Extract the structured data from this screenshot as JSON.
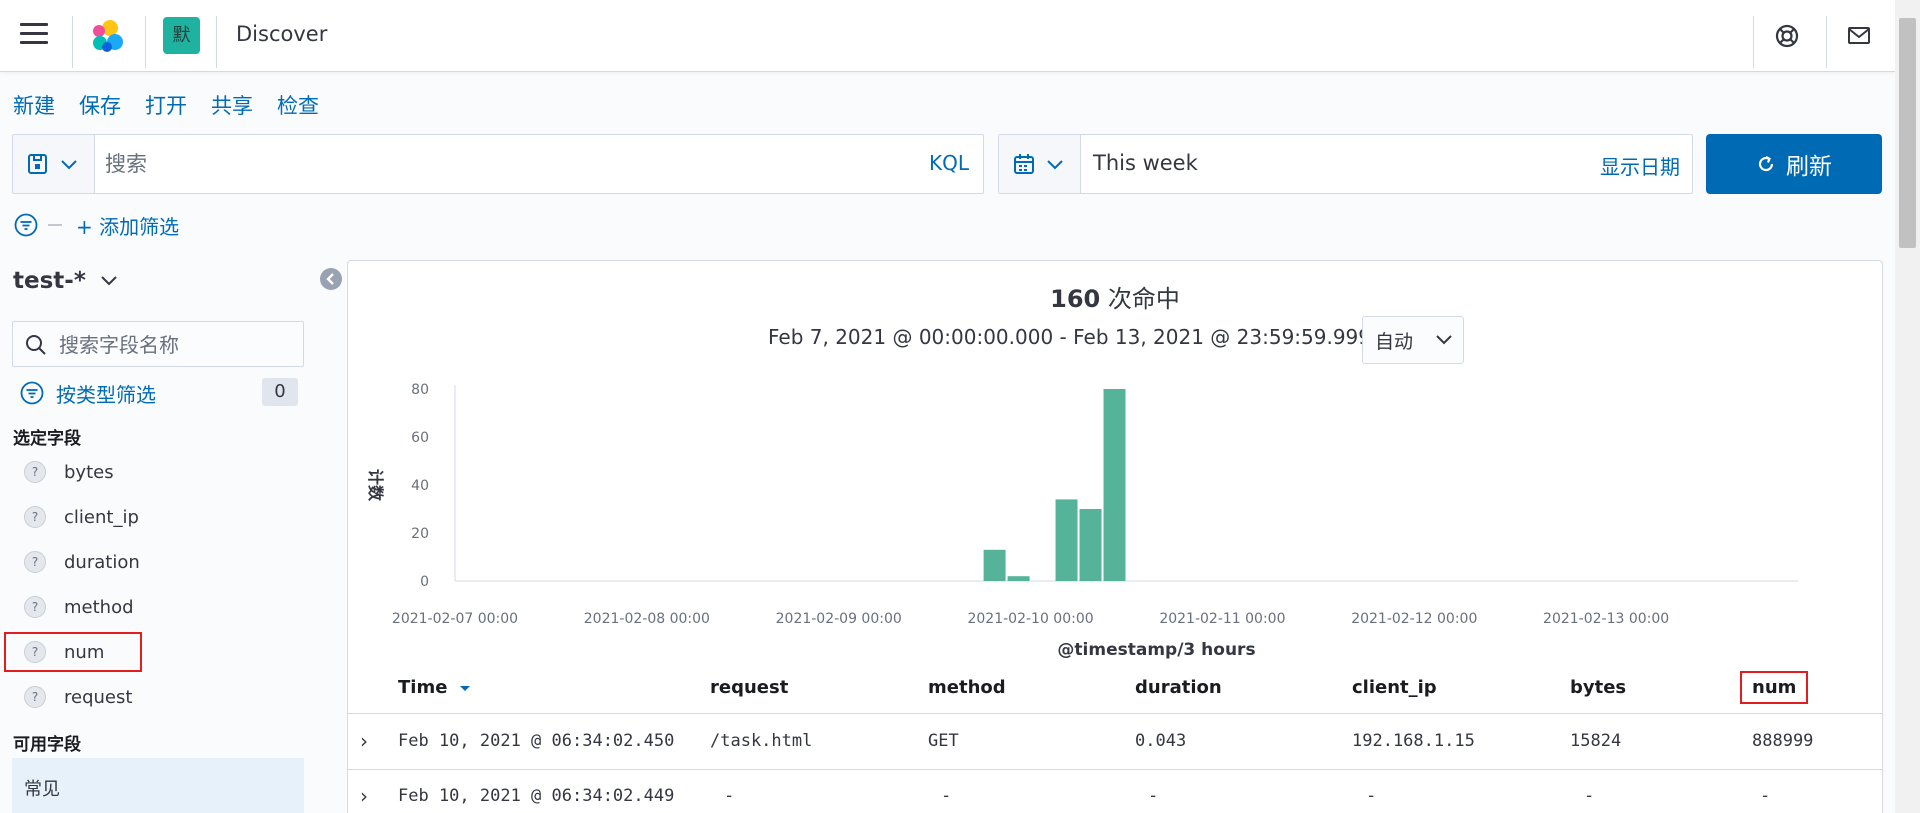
{
  "header": {
    "title": "Discover",
    "space_avatar": "默",
    "icons": [
      "menu-icon",
      "elastic-logo",
      "help-icon",
      "mail-icon"
    ]
  },
  "topnav": [
    "新建",
    "保存",
    "打开",
    "共享",
    "检查"
  ],
  "query": {
    "placeholder": "搜索",
    "language": "KQL"
  },
  "time": {
    "range": "This week",
    "show_dates": "显示日期"
  },
  "refresh_label": "刷新",
  "add_filter": "+ 添加筛选",
  "sidebar": {
    "index_pattern": "test-*",
    "search_placeholder": "搜索字段名称",
    "filter_by_type": "按类型筛选",
    "filter_count": "0",
    "selected_title": "选定字段",
    "selected_fields": [
      "bytes",
      "client_ip",
      "duration",
      "method",
      "num",
      "request"
    ],
    "available_title": "可用字段",
    "common_label": "常见"
  },
  "main": {
    "hits_count": "160",
    "hits_label": " 次命中",
    "time_range": "Feb 7, 2021 @ 00:00:00.000 - Feb 13, 2021 @ 23:59:59.999",
    "interval": "自动"
  },
  "chart_data": {
    "type": "bar",
    "ylabel": "计数",
    "xlabel": "@timestamp/3 hours",
    "ylim": [
      0,
      80
    ],
    "yticks": [
      0,
      20,
      40,
      60,
      80
    ],
    "xticks": [
      "2021-02-07 00:00",
      "2021-02-08 00:00",
      "2021-02-09 00:00",
      "2021-02-10 00:00",
      "2021-02-11 00:00",
      "2021-02-12 00:00",
      "2021-02-13 00:00"
    ],
    "bar_color": "#54b399",
    "bars": [
      {
        "x": "2021-02-09 18:00",
        "value": 13
      },
      {
        "x": "2021-02-09 21:00",
        "value": 2
      },
      {
        "x": "2021-02-10 03:00",
        "value": 34
      },
      {
        "x": "2021-02-10 06:00",
        "value": 30
      },
      {
        "x": "2021-02-10 09:00",
        "value": 80
      }
    ]
  },
  "table": {
    "columns": [
      "Time",
      "request",
      "method",
      "duration",
      "client_ip",
      "bytes",
      "num"
    ],
    "rows": [
      [
        "Feb 10, 2021 @ 06:34:02.450",
        "/task.html",
        "GET",
        "0.043",
        "192.168.1.15",
        "15824",
        "888999"
      ],
      [
        "Feb 10, 2021 @ 06:34:02.449",
        "-",
        "-",
        "-",
        "-",
        "-",
        "-"
      ]
    ]
  },
  "colors": {
    "accent": "#006bb4",
    "highlight": "#e11d1d",
    "bar": "#54b399"
  }
}
